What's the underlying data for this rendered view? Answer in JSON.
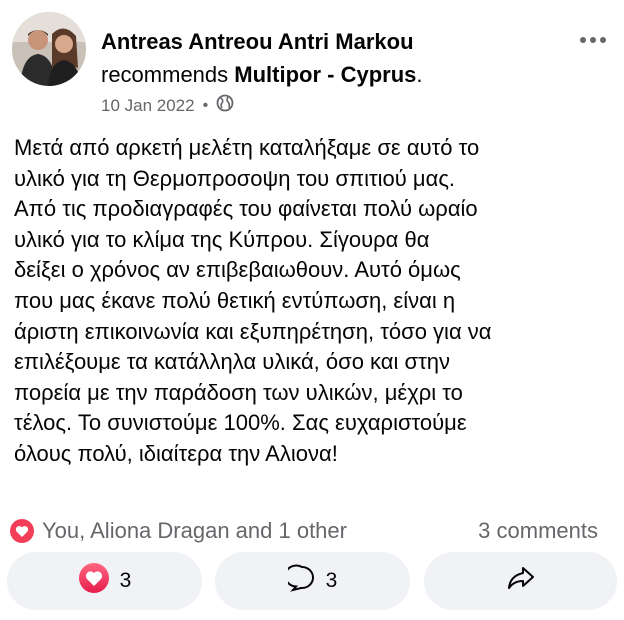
{
  "post": {
    "author": "Antreas Antreou Antri Markou",
    "verb": "recommends",
    "page_name": "Multipor - Cyprus",
    "page_suffix": ".",
    "date": "10 Jan 2022",
    "separator": "•",
    "privacy_icon": "globe-icon",
    "more_icon": "more-horizontal-icon",
    "body_lines": [
      "Μετά από αρκετή μελέτη καταλήξαμε σε αυτό το",
      "υλικό για τη Θερμοπροσοψη του σπιτιού μας.",
      "Από τις προδιαγραφές του φαίνεται πολύ ωραίο",
      "υλικό για το κλίμα της Κύπρου. Σίγουρα θα",
      "δείξει ο χρόνος αν επιβεβαιωθουν. Αυτό όμως",
      "που μας έκανε πολύ θετική εντύπωση, είναι η",
      "άριστη επικοινωνία και εξυπηρέτηση, τόσο για να",
      "επιλέξουμε τα κατάλληλα υλικά, όσο και στην",
      "πορεία με την παράδοση των υλικών, μέχρι το",
      "τέλος. Το συνιστούμε 100%. Σας ευχαριστούμε",
      "όλους πολύ, ιδιαίτερα την Αλιονα!"
    ]
  },
  "reactions": {
    "summary": "You, Aliona Dragan and 1 other",
    "comments": "3 comments",
    "icon": "heart-icon"
  },
  "actions": {
    "like_count": "3",
    "comment_count": "3",
    "like_icon": "heart-icon",
    "comment_icon": "comment-bubble-icon",
    "share_icon": "share-arrow-icon"
  },
  "colors": {
    "heart": "#f33e58",
    "secondary_text": "#65676b",
    "button_bg": "#f0f2f5"
  }
}
